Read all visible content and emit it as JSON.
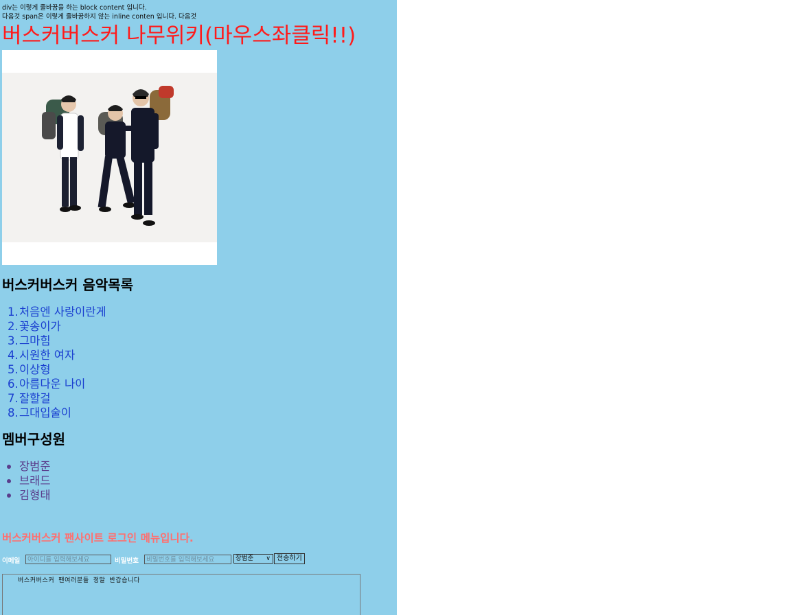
{
  "intro": {
    "div_note": "div는 이렇게 줄바꿈을 하는 block content 입니다.",
    "span_note": "다음것 span은 이렇게 줄바꿈하지 않는 inline conten 입니다. 다음것"
  },
  "wiki_link_text": "버스커버스커 나무위키(마우스좌클릭!!)",
  "music": {
    "heading": "버스커버스커 음악목록",
    "songs": [
      {
        "num": "1.",
        "title": "처음엔 사랑이란게"
      },
      {
        "num": "2.",
        "title": "꽃송이가"
      },
      {
        "num": "3.",
        "title": "그마힘"
      },
      {
        "num": "4.",
        "title": "시원한 여자"
      },
      {
        "num": "5.",
        "title": "이상형"
      },
      {
        "num": "6.",
        "title": "아름다운 나이"
      },
      {
        "num": "7.",
        "title": "잘할걸"
      },
      {
        "num": "8.",
        "title": "그대입술이"
      }
    ]
  },
  "members": {
    "heading": "멤버구성원",
    "list": [
      "장범준",
      "브래드",
      "김형태"
    ]
  },
  "login": {
    "title": "버스커버스커 팬사이트 로그인 메뉴입니다.",
    "email_label": "이메일",
    "email_placeholder": "아이디를 입력해보세요",
    "password_label": "비밀번호",
    "password_placeholder": "비밀번호를 입력해보세요",
    "select_value": "장범준",
    "submit_label": "전송하기",
    "message_text": "버스커버스커 팬여러분들 정말 반갑습니다"
  },
  "colors": {
    "background": "#8ecfea",
    "wiki_link": "#ff1a1a",
    "song_link": "#1a3fd0",
    "member_link": "#5a3d8c",
    "login_title": "#ff6f6f"
  }
}
